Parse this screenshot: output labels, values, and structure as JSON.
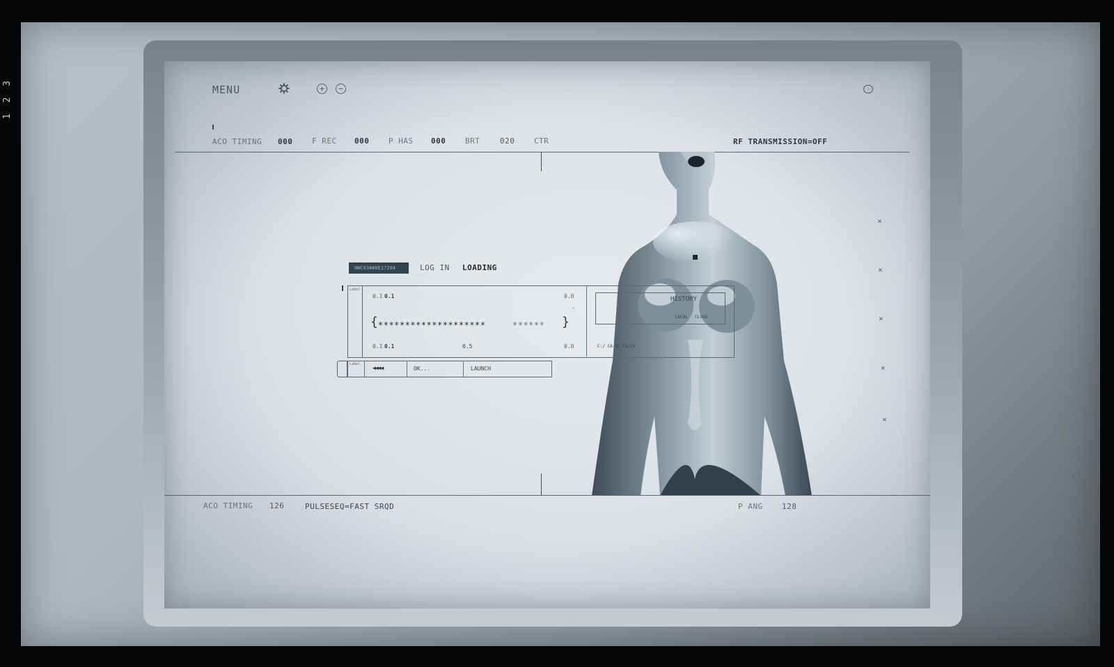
{
  "film_strip": {
    "frame_number": "1 2 3"
  },
  "header": {
    "menu_label": "MENU",
    "stats": [
      {
        "label": "ACO TIMING",
        "value": "000"
      },
      {
        "label": "F REC",
        "value": "000"
      },
      {
        "label": "P HAS",
        "value": "000"
      },
      {
        "label": "BRT",
        "value": "020"
      },
      {
        "label": "CTR",
        "value": ""
      }
    ],
    "rf_status": "RF TRANSMISSION=OFF"
  },
  "login_panel": {
    "status_chip": "NWC03##0E17284",
    "login_tab": "LOG IN",
    "loading_tab": "LOADING",
    "field_label": "Label",
    "top_left_values": [
      "0.1",
      "0.1"
    ],
    "top_right_value": "0.0",
    "password_mask": "********************",
    "password_mask_faded": "******",
    "bottom_left_values": [
      "0.1",
      "0.1"
    ],
    "bottom_mid_value": "0.5",
    "bottom_right_value": "0.0",
    "history_label": "HISTORY",
    "local_label": "LOCAL",
    "cloud_label": "CLOUD",
    "path_text": "C:/ CA-AC-CS-CA",
    "action_row": {
      "label": "Label",
      "progress_glyphs": "◀◀◀◀",
      "ok_label": "OK...",
      "launch_label": "LAUNCH"
    }
  },
  "footer": {
    "aco_label": "ACO TIMING",
    "aco_value": "126",
    "pulse_label": "PULSESEQ=FAST SRQD",
    "pang_label": "P ANG",
    "pang_value": "128"
  },
  "side_marks": [
    "×",
    "×",
    "×",
    "×",
    "×"
  ],
  "colors": {
    "screen": "#e3e7eb",
    "chip": "#2f4450",
    "ink": "#2c3640"
  }
}
